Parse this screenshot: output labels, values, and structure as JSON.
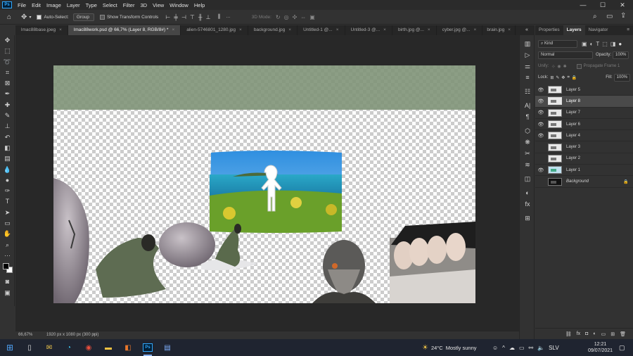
{
  "app": {
    "logo": "Ps",
    "menu": [
      "File",
      "Edit",
      "Image",
      "Layer",
      "Type",
      "Select",
      "Filter",
      "3D",
      "View",
      "Window",
      "Help"
    ],
    "window_controls": {
      "minimize": "—",
      "maximize": "☐",
      "close": "✕"
    }
  },
  "options": {
    "auto_select_label": "Auto-Select:",
    "auto_select_checked": true,
    "auto_select_target": "Group",
    "transform_controls_label": "Show Transform Controls",
    "mode_3d_label": "3D Mode:",
    "more_label": "···"
  },
  "tabs": [
    {
      "label": "lmac88base.jpeg",
      "close": "×",
      "active": false
    },
    {
      "label": "lmac88work.psd @ 66,7% (Layer 8, RGB/8#) *",
      "close": "×",
      "active": true
    },
    {
      "label": "alien-5746801_1280.jpg",
      "close": "×",
      "active": false
    },
    {
      "label": "background.jpg",
      "close": "×",
      "active": false
    },
    {
      "label": "Untitled-1 @...",
      "close": "×",
      "active": false
    },
    {
      "label": "Untitled-3 @...",
      "close": "×",
      "active": false
    },
    {
      "label": "birth.jpg @...",
      "close": "×",
      "active": false
    },
    {
      "label": "cyber.jpg @...",
      "close": "×",
      "active": false
    },
    {
      "label": "brain.jpg",
      "close": "×",
      "active": false
    }
  ],
  "tabs_overflow": "»",
  "status": {
    "zoom": "66,67%",
    "doc_info": "1920 px x 1080 px (300 ppi)"
  },
  "panel": {
    "tabs": [
      "Properties",
      "Layers",
      "Navigator"
    ],
    "active_tab": "Layers",
    "filter_label": "Kind",
    "blend_mode": "Normal",
    "opacity_label": "Opacity:",
    "opacity_value": "100%",
    "unify_label": "Unify:",
    "propagate_label": "Propagate Frame 1",
    "lock_label": "Lock:",
    "fill_label": "Fill:",
    "fill_value": "100%",
    "layers": [
      {
        "name": "Layer 5",
        "visible": true,
        "selected": false
      },
      {
        "name": "Layer 8",
        "visible": true,
        "selected": true
      },
      {
        "name": "Layer 7",
        "visible": true,
        "selected": false
      },
      {
        "name": "Layer 6",
        "visible": true,
        "selected": false
      },
      {
        "name": "Layer 4",
        "visible": true,
        "selected": false
      },
      {
        "name": "Layer 3",
        "visible": false,
        "selected": false
      },
      {
        "name": "Layer 2",
        "visible": false,
        "selected": false
      },
      {
        "name": "Layer 1",
        "visible": true,
        "selected": false
      },
      {
        "name": "Background",
        "visible": false,
        "selected": false,
        "locked": true
      }
    ]
  },
  "taskbar": {
    "weather_temp": "24°C",
    "weather_text": "Mostly sunny",
    "language": "SLV",
    "time": "12:21",
    "date": "09/07/2021"
  }
}
